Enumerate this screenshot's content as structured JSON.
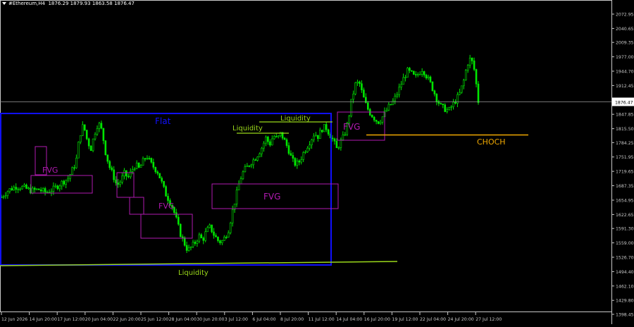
{
  "window": {
    "symbol": "#Ethereum,H4",
    "ohlc": "1876.29 1879.93 1863.58 1876.47"
  },
  "price_axis": {
    "ticks": [
      "2072.95",
      "2040.65",
      "2009.35",
      "1977.00",
      "1944.70",
      "1912.45",
      "1880.14",
      "1847.85",
      "1815.50",
      "1784.25",
      "1751.95",
      "1719.65",
      "1687.35",
      "1654.95",
      "1622.65",
      "1591.30",
      "1559.00",
      "1526.70",
      "1494.40",
      "1462.10",
      "1429.80",
      "1398.45"
    ],
    "current_price": "1876.47"
  },
  "time_axis": {
    "ticks": [
      "12 Jun 2026",
      "14 Jun 20:00",
      "17 Jun 12:00",
      "20 Jun 04:00",
      "22 Jun 20:00",
      "25 Jun 12:00",
      "28 Jun 04:00",
      "30 Jun 20:00",
      "3 Jul 12:00",
      "6 Jul 04:00",
      "8 Jul 20:00",
      "11 Jul 12:00",
      "14 Jul 04:00",
      "16 Jul 20:00",
      "19 Jul 12:00",
      "22 Jul 04:00",
      "24 Jul 20:00",
      "27 Jul 12:00"
    ]
  },
  "annotations": {
    "flat": "Flat",
    "fvg": "FVG",
    "liquidity": "Liquidity",
    "choch": "CHOCH"
  },
  "colors": {
    "background": "#000000",
    "candle": "#00e600",
    "axis_text": "#c8c8c8",
    "flat_box": "#1010ff",
    "fvg_box": "#b01ab0",
    "fvg_text": "#b01ab0",
    "liquidity": "#9ad81a",
    "choch": "#f0a800",
    "price_line": "#9a9a9a"
  },
  "chart_data": {
    "type": "candlestick",
    "price_range": [
      1398.45,
      2072.95
    ],
    "close_path": [
      [
        0,
        1662
      ],
      [
        2,
        1678
      ],
      [
        4,
        1686
      ],
      [
        6,
        1683
      ],
      [
        8,
        1676
      ],
      [
        10,
        1679
      ],
      [
        12,
        1672
      ],
      [
        14,
        1680
      ],
      [
        16,
        1693
      ],
      [
        18,
        1705
      ],
      [
        20,
        1740
      ],
      [
        21,
        1800
      ],
      [
        22,
        1825
      ],
      [
        23,
        1790
      ],
      [
        24,
        1770
      ],
      [
        25,
        1805
      ],
      [
        26,
        1830
      ],
      [
        27,
        1810
      ],
      [
        28,
        1760
      ],
      [
        29,
        1730
      ],
      [
        30,
        1710
      ],
      [
        31,
        1688
      ],
      [
        32,
        1698
      ],
      [
        33,
        1715
      ],
      [
        34,
        1705
      ],
      [
        35,
        1722
      ],
      [
        36,
        1735
      ],
      [
        37,
        1725
      ],
      [
        38,
        1742
      ],
      [
        39,
        1755
      ],
      [
        40,
        1738
      ],
      [
        41,
        1728
      ],
      [
        42,
        1718
      ],
      [
        43,
        1695
      ],
      [
        44,
        1670
      ],
      [
        45,
        1655
      ],
      [
        46,
        1638
      ],
      [
        47,
        1610
      ],
      [
        48,
        1580
      ],
      [
        49,
        1560
      ],
      [
        50,
        1542
      ],
      [
        51,
        1550
      ],
      [
        52,
        1560
      ],
      [
        53,
        1575
      ],
      [
        54,
        1565
      ],
      [
        55,
        1585
      ],
      [
        56,
        1595
      ],
      [
        57,
        1578
      ],
      [
        58,
        1565
      ],
      [
        59,
        1560
      ],
      [
        60,
        1572
      ],
      [
        61,
        1590
      ],
      [
        62,
        1630
      ],
      [
        63,
        1665
      ],
      [
        64,
        1700
      ],
      [
        65,
        1720
      ],
      [
        66,
        1730
      ],
      [
        67,
        1740
      ],
      [
        68,
        1748
      ],
      [
        69,
        1760
      ],
      [
        70,
        1775
      ],
      [
        71,
        1795
      ],
      [
        72,
        1780
      ],
      [
        73,
        1800
      ],
      [
        74,
        1792
      ],
      [
        75,
        1805
      ],
      [
        76,
        1788
      ],
      [
        77,
        1770
      ],
      [
        78,
        1745
      ],
      [
        79,
        1735
      ],
      [
        80,
        1742
      ],
      [
        81,
        1760
      ],
      [
        82,
        1775
      ],
      [
        83,
        1790
      ],
      [
        84,
        1805
      ],
      [
        85,
        1798
      ],
      [
        86,
        1815
      ],
      [
        87,
        1820
      ],
      [
        88,
        1805
      ],
      [
        89,
        1790
      ],
      [
        90,
        1770
      ],
      [
        91,
        1785
      ],
      [
        92,
        1800
      ],
      [
        93,
        1830
      ],
      [
        94,
        1880
      ],
      [
        95,
        1915
      ],
      [
        96,
        1920
      ],
      [
        97,
        1890
      ],
      [
        98,
        1865
      ],
      [
        99,
        1850
      ],
      [
        100,
        1840
      ],
      [
        101,
        1830
      ],
      [
        102,
        1838
      ],
      [
        103,
        1852
      ],
      [
        104,
        1865
      ],
      [
        105,
        1875
      ],
      [
        106,
        1890
      ],
      [
        107,
        1910
      ],
      [
        108,
        1930
      ],
      [
        109,
        1945
      ],
      [
        110,
        1940
      ],
      [
        111,
        1930
      ],
      [
        112,
        1940
      ],
      [
        113,
        1950
      ],
      [
        114,
        1935
      ],
      [
        115,
        1920
      ],
      [
        116,
        1900
      ],
      [
        117,
        1880
      ],
      [
        118,
        1865
      ],
      [
        119,
        1860
      ],
      [
        120,
        1855
      ],
      [
        121,
        1868
      ],
      [
        122,
        1880
      ],
      [
        123,
        1895
      ],
      [
        124,
        1920
      ],
      [
        125,
        1960
      ],
      [
        126,
        1975
      ],
      [
        127,
        1945
      ],
      [
        128,
        1877
      ]
    ]
  }
}
